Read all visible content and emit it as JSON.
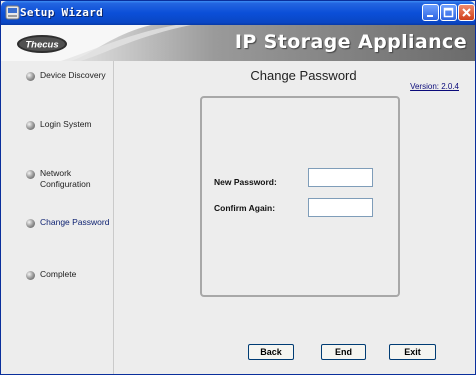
{
  "window": {
    "title": "Setup Wizard",
    "icons": {
      "app": "app-icon",
      "minimize": "minimize-icon",
      "maximize": "maximize-icon",
      "close": "close-icon"
    },
    "colors": {
      "titlebar": "#0b4fd8",
      "close_button": "#d0401a"
    }
  },
  "banner": {
    "brand": "Thecus",
    "title": "IP Storage Appliance"
  },
  "sidebar": {
    "items": [
      {
        "label": "Device Discovery",
        "active": false
      },
      {
        "label": "Login System",
        "active": false
      },
      {
        "label": "Network Configuration",
        "active": false
      },
      {
        "label": "Change Password",
        "active": true
      },
      {
        "label": "Complete",
        "active": false
      }
    ]
  },
  "main": {
    "title": "Change Password",
    "version": "Version: 2.0.4",
    "fields": [
      {
        "label": "New Password:",
        "value": ""
      },
      {
        "label": "Confirm Again:",
        "value": ""
      }
    ]
  },
  "buttons": {
    "back": "Back",
    "end": "End",
    "exit": "Exit"
  }
}
